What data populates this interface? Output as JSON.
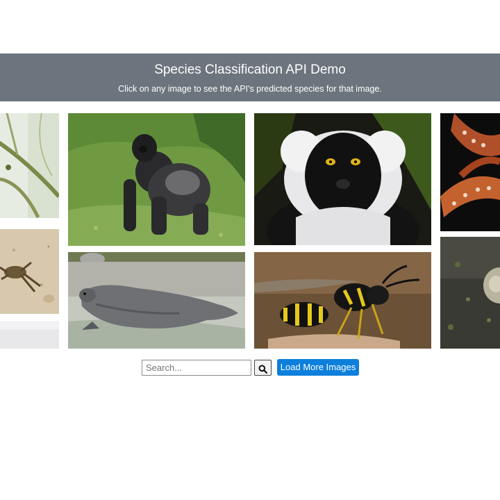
{
  "header": {
    "title": "Species Classification API Demo",
    "subtitle": "Click on any image to see the API's predicted species for that image."
  },
  "gallery": {
    "images": [
      {
        "subject": "tree-branches-photo"
      },
      {
        "subject": "crab-photo"
      },
      {
        "subject": "pale-partial-photo"
      },
      {
        "subject": "gorilla-photo"
      },
      {
        "subject": "seal-photo"
      },
      {
        "subject": "lemur-photo"
      },
      {
        "subject": "wasp-photo"
      },
      {
        "subject": "octopus-photo"
      },
      {
        "subject": "frog-photo"
      }
    ]
  },
  "search": {
    "placeholder": "Search...",
    "icon": "magnifier-icon"
  },
  "load_more": {
    "label": "Load More Images"
  },
  "colors": {
    "header_bg": "#6c757d",
    "accent": "#0d7fdc"
  }
}
